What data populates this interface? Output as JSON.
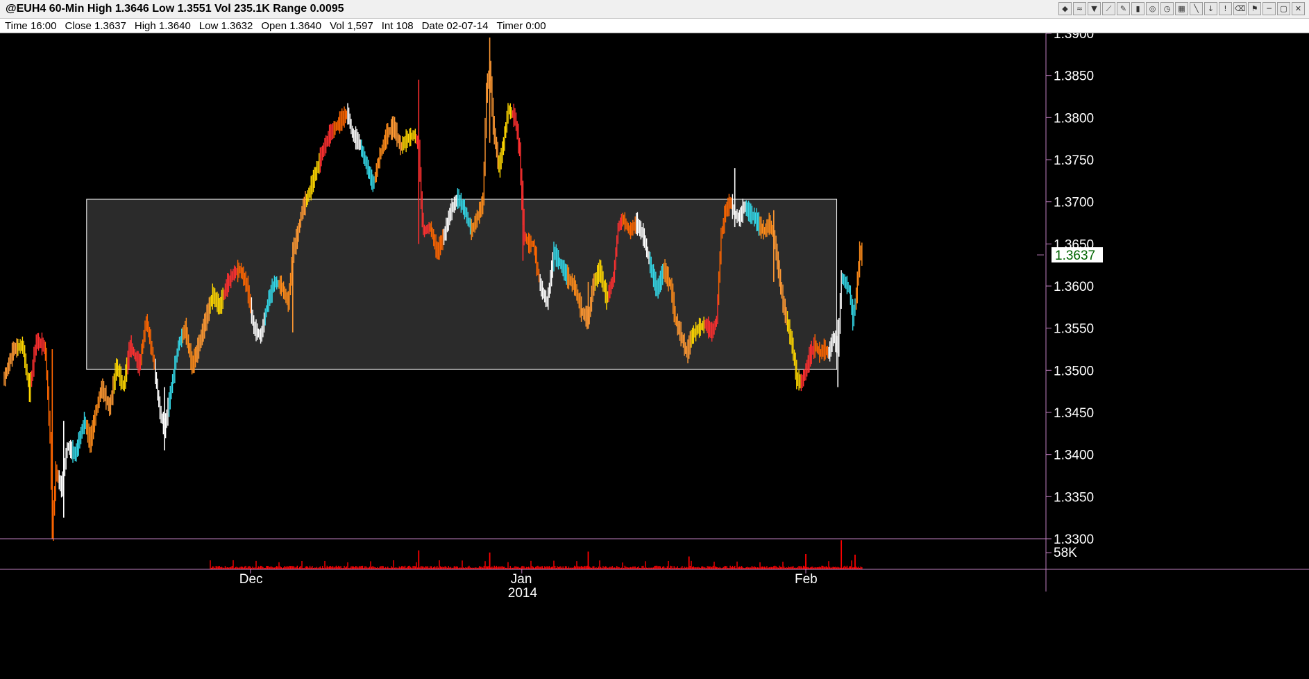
{
  "window": {
    "title": "@EUH4 60-Min High 1.3646 Low 1.3551 Vol 235.1K Range 0.0095",
    "toolbar_icons": [
      "chart-type-icon",
      "overlay-icon",
      "indicator-icon",
      "draw-line-icon",
      "pencil-icon",
      "bar-icon",
      "marker-icon",
      "clock-icon",
      "table-icon",
      "trend-line-icon",
      "arrow-down-icon",
      "alert-icon",
      "delete-icon",
      "flag-icon",
      "minimize-icon",
      "maximize-icon",
      "close-icon"
    ]
  },
  "info": {
    "time": "Time 16:00",
    "close": "Close 1.3637",
    "high": "High 1.3640",
    "low": "Low 1.3632",
    "open": "Open 1.3640",
    "vol": "Vol 1,597",
    "int": "Int 108",
    "date": "Date 02-07-14",
    "timer": "Timer 0:00"
  },
  "colors": {
    "background": "#000000",
    "axis": "#c080c0",
    "volume": "#ff0000",
    "range_box_fill": "#2b2b2b",
    "range_box_stroke": "#ffffff",
    "price_badge_bg": "#ffffff",
    "price_badge_text": "#006400",
    "palette": [
      "#ff9933",
      "#ffd700",
      "#ff3030",
      "#ff6600",
      "#ffffff",
      "#33d6e6",
      "#ff8c1a"
    ]
  },
  "chart_data": {
    "type": "bar",
    "ylim": [
      1.33,
      1.39
    ],
    "y_ticks": [
      "1.3900",
      "1.3850",
      "1.3800",
      "1.3750",
      "1.3700",
      "1.3650",
      "1.3600",
      "1.3550",
      "1.3500",
      "1.3450",
      "1.3400",
      "1.3350",
      "1.3300"
    ],
    "x_ticks": [
      {
        "label": "Dec",
        "index": 215
      },
      {
        "label": "Jan",
        "index": 452
      },
      {
        "label": "Feb",
        "index": 700
      }
    ],
    "x_year_label": "2014",
    "bar_count": 750,
    "last_price": "1.3637",
    "range_box": {
      "start_index": 72,
      "end_index": 727,
      "top": 1.3703,
      "bottom": 1.3501
    },
    "price_path": [
      [
        0,
        1.349
      ],
      [
        8,
        1.3525
      ],
      [
        16,
        1.353
      ],
      [
        22,
        1.3475
      ],
      [
        28,
        1.3535
      ],
      [
        34,
        1.353
      ],
      [
        36,
        1.352
      ],
      [
        40,
        1.342
      ],
      [
        42,
        1.331
      ],
      [
        45,
        1.338
      ],
      [
        50,
        1.336
      ],
      [
        55,
        1.341
      ],
      [
        62,
        1.34
      ],
      [
        70,
        1.344
      ],
      [
        75,
        1.3415
      ],
      [
        80,
        1.345
      ],
      [
        85,
        1.348
      ],
      [
        92,
        1.3455
      ],
      [
        98,
        1.3505
      ],
      [
        104,
        1.348
      ],
      [
        110,
        1.353
      ],
      [
        118,
        1.3505
      ],
      [
        124,
        1.356
      ],
      [
        130,
        1.3515
      ],
      [
        136,
        1.345
      ],
      [
        140,
        1.343
      ],
      [
        146,
        1.348
      ],
      [
        152,
        1.353
      ],
      [
        158,
        1.355
      ],
      [
        164,
        1.3505
      ],
      [
        170,
        1.353
      ],
      [
        176,
        1.356
      ],
      [
        182,
        1.359
      ],
      [
        188,
        1.3575
      ],
      [
        194,
        1.36
      ],
      [
        200,
        1.3615
      ],
      [
        206,
        1.362
      ],
      [
        212,
        1.36
      ],
      [
        218,
        1.355
      ],
      [
        224,
        1.354
      ],
      [
        230,
        1.358
      ],
      [
        236,
        1.3605
      ],
      [
        242,
        1.36
      ],
      [
        248,
        1.358
      ],
      [
        252,
        1.364
      ],
      [
        256,
        1.366
      ],
      [
        260,
        1.369
      ],
      [
        266,
        1.371
      ],
      [
        272,
        1.3735
      ],
      [
        278,
        1.376
      ],
      [
        284,
        1.378
      ],
      [
        290,
        1.379
      ],
      [
        296,
        1.38
      ],
      [
        300,
        1.3805
      ],
      [
        304,
        1.378
      ],
      [
        310,
        1.377
      ],
      [
        316,
        1.3745
      ],
      [
        322,
        1.372
      ],
      [
        328,
        1.3755
      ],
      [
        334,
        1.378
      ],
      [
        340,
        1.379
      ],
      [
        346,
        1.3765
      ],
      [
        352,
        1.3775
      ],
      [
        358,
        1.378
      ],
      [
        362,
        1.3765
      ],
      [
        364,
        1.37
      ],
      [
        366,
        1.3665
      ],
      [
        372,
        1.367
      ],
      [
        378,
        1.364
      ],
      [
        384,
        1.366
      ],
      [
        390,
        1.369
      ],
      [
        396,
        1.3705
      ],
      [
        402,
        1.369
      ],
      [
        408,
        1.3665
      ],
      [
        414,
        1.3685
      ],
      [
        418,
        1.37
      ],
      [
        421,
        1.383
      ],
      [
        424,
        1.386
      ],
      [
        427,
        1.379
      ],
      [
        432,
        1.374
      ],
      [
        436,
        1.377
      ],
      [
        440,
        1.381
      ],
      [
        446,
        1.38
      ],
      [
        450,
        1.376
      ],
      [
        452,
        1.37
      ],
      [
        454,
        1.366
      ],
      [
        458,
        1.365
      ],
      [
        462,
        1.365
      ],
      [
        468,
        1.36
      ],
      [
        474,
        1.358
      ],
      [
        480,
        1.364
      ],
      [
        486,
        1.3625
      ],
      [
        492,
        1.361
      ],
      [
        498,
        1.36
      ],
      [
        504,
        1.357
      ],
      [
        510,
        1.356
      ],
      [
        514,
        1.36
      ],
      [
        520,
        1.362
      ],
      [
        526,
        1.3585
      ],
      [
        532,
        1.361
      ],
      [
        536,
        1.367
      ],
      [
        540,
        1.368
      ],
      [
        546,
        1.3665
      ],
      [
        552,
        1.3675
      ],
      [
        558,
        1.366
      ],
      [
        564,
        1.3625
      ],
      [
        570,
        1.3595
      ],
      [
        576,
        1.362
      ],
      [
        582,
        1.36
      ],
      [
        586,
        1.356
      ],
      [
        590,
        1.3545
      ],
      [
        596,
        1.352
      ],
      [
        600,
        1.354
      ],
      [
        606,
        1.355
      ],
      [
        612,
        1.3555
      ],
      [
        618,
        1.3545
      ],
      [
        622,
        1.356
      ],
      [
        626,
        1.366
      ],
      [
        630,
        1.369
      ],
      [
        634,
        1.37
      ],
      [
        638,
        1.3685
      ],
      [
        642,
        1.368
      ],
      [
        646,
        1.3695
      ],
      [
        652,
        1.3685
      ],
      [
        656,
        1.368
      ],
      [
        660,
        1.367
      ],
      [
        664,
        1.3665
      ],
      [
        668,
        1.3675
      ],
      [
        672,
        1.366
      ],
      [
        676,
        1.362
      ],
      [
        680,
        1.358
      ],
      [
        684,
        1.3555
      ],
      [
        688,
        1.353
      ],
      [
        692,
        1.349
      ],
      [
        696,
        1.3485
      ],
      [
        700,
        1.35
      ],
      [
        704,
        1.352
      ],
      [
        708,
        1.353
      ],
      [
        712,
        1.352
      ],
      [
        716,
        1.3525
      ],
      [
        720,
        1.352
      ],
      [
        724,
        1.354
      ],
      [
        728,
        1.3525
      ],
      [
        731,
        1.361
      ],
      [
        734,
        1.3605
      ],
      [
        738,
        1.3595
      ],
      [
        741,
        1.356
      ],
      [
        744,
        1.359
      ],
      [
        747,
        1.364
      ],
      [
        749,
        1.3637
      ]
    ],
    "spikes": [
      {
        "index": 42,
        "low": 1.33,
        "high": 1.3525
      },
      {
        "index": 52,
        "low": 1.3325,
        "high": 1.344
      },
      {
        "index": 140,
        "low": 1.3405,
        "high": 1.348
      },
      {
        "index": 252,
        "low": 1.3545,
        "high": 1.363
      },
      {
        "index": 362,
        "low": 1.365,
        "high": 1.3845
      },
      {
        "index": 424,
        "low": 1.377,
        "high": 1.3895
      },
      {
        "index": 453,
        "low": 1.363,
        "high": 1.3725
      },
      {
        "index": 510,
        "low": 1.355,
        "high": 1.3605
      },
      {
        "index": 638,
        "low": 1.367,
        "high": 1.374
      },
      {
        "index": 672,
        "low": 1.3605,
        "high": 1.369
      },
      {
        "index": 728,
        "low": 1.348,
        "high": 1.356
      }
    ],
    "volume": {
      "tick_label": "58K",
      "spikes": [
        {
          "index": 362,
          "value": 0.62
        },
        {
          "index": 424,
          "value": 0.55
        },
        {
          "index": 510,
          "value": 0.58
        },
        {
          "index": 598,
          "value": 0.42
        },
        {
          "index": 700,
          "value": 0.5
        },
        {
          "index": 731,
          "value": 0.95
        },
        {
          "index": 743,
          "value": 0.48
        }
      ]
    }
  }
}
